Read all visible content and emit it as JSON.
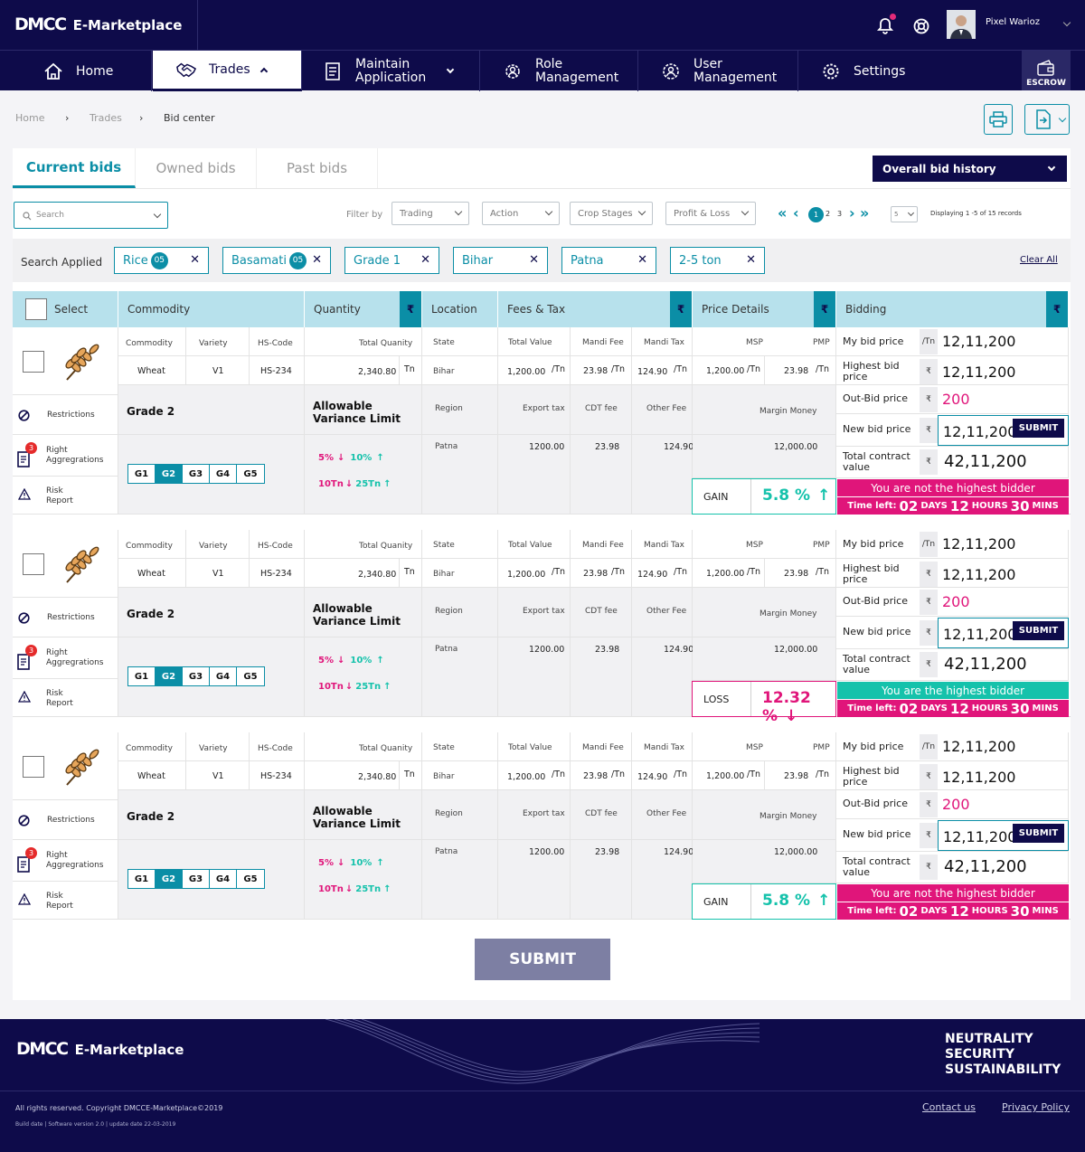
{
  "header": {
    "logo_mark": "DMCC",
    "logo_text": "E-Marketplace",
    "user_name": "Pixel Warioz"
  },
  "nav": {
    "home": "Home",
    "trades": "Trades",
    "maintain_1": "Maintain",
    "maintain_2": "Application",
    "role_1": "Role",
    "role_2": "Management",
    "user_1": "User",
    "user_2": "Management",
    "settings": "Settings",
    "escrow": "ESCROW"
  },
  "breadcrumb": [
    "Home",
    "Trades",
    "Bid center"
  ],
  "tabs": [
    "Current bids",
    "Owned bids",
    "Past bids"
  ],
  "history_select": "Overall bid history",
  "filters": {
    "search_placeholder": "Search",
    "filter_by": "Filter by",
    "trading": "Trading",
    "action": "Action",
    "crop_stages": "Crop Stages",
    "profit_loss": "Profit & Loss",
    "pages": [
      "1",
      "2",
      "3"
    ],
    "per_page": "5",
    "displaying": "Displaying 1 -5 of 15 records"
  },
  "applied": {
    "label": "Search Applied",
    "chips": [
      {
        "label": "Rice",
        "count": "05"
      },
      {
        "label": "Basamati",
        "count": "05"
      },
      {
        "label": "Grade 1",
        "count": ""
      },
      {
        "label": "Bihar",
        "count": ""
      },
      {
        "label": "Patna",
        "count": ""
      },
      {
        "label": "2-5 ton",
        "count": ""
      }
    ],
    "clear_all": "Clear All"
  },
  "table_headers": {
    "select": "Select",
    "commodity": "Commodity",
    "quantity": "Quantity",
    "location": "Location",
    "fees": "Fees & Tax",
    "price": "Price Details",
    "bidding": "Bidding",
    "rupee": "₹"
  },
  "labels": {
    "commodity": "Commodity",
    "variety": "Variety",
    "hs_code": "HS-Code",
    "total_quantity": "Total Quanity",
    "state": "State",
    "total_value": "Total Value",
    "mandi_fee": "Mandi Fee",
    "mandi_tax": "Mandi Tax",
    "msp": "MSP",
    "pmp": "PMP",
    "region": "Region",
    "export_tax": "Export tax",
    "cdt_fee": "CDT fee",
    "other_fee": "Other Fee",
    "margin_money": "Margin Money",
    "restrictions": "Restrictions",
    "right_1": "Right",
    "right_2": "Aggregrations",
    "risk_1": "Risk",
    "risk_2": "Report",
    "allowable_1": "Allowable",
    "allowable_2": "Variance Limit",
    "my_bid": "My bid price",
    "highest_1": "Highest bid",
    "highest_2": "price",
    "outbid": "Out-Bid price",
    "new_bid": "New bid price",
    "total_1": "Total contract",
    "total_2": "value",
    "per_tn": "/Tn",
    "tn": "Tn",
    "submit_small": "SUBMIT",
    "time_left": "Time left:",
    "days": "DAYS",
    "hours": "HOURS",
    "mins": "MINS",
    "gains": [
      "G1",
      "G2",
      "G3",
      "G4",
      "G5"
    ],
    "var": [
      "5%",
      "10%",
      "10Tn",
      "25Tn"
    ]
  },
  "rows": [
    {
      "commodity": "Wheat",
      "variety": "V1",
      "hs_code": "HS-234",
      "quantity": "2,340.80",
      "state": "Bihar",
      "total_value": "1,200.00",
      "mandi_fee": "23.98",
      "mandi_tax": "124.90",
      "msp": "1,200.00",
      "pmp": "23.98",
      "grade": "Grade 2",
      "region": "Patna",
      "export_tax": "1200.00",
      "cdt_fee": "23.98",
      "other_fee": "124.90",
      "margin_money": "12,000.00",
      "badge": "3",
      "my_bid": "12,11,200",
      "highest": "12,11,200",
      "outbid": "200",
      "new_bid": "12,11,200",
      "total_contract": "42,11,200",
      "pl_label": "GAIN",
      "pl_value": "5.8 %",
      "pl_type": "gain",
      "status": "You are not the highest bidder",
      "status_type": "not",
      "t_days": "02",
      "t_hours": "12",
      "t_mins": "30"
    },
    {
      "commodity": "Wheat",
      "variety": "V1",
      "hs_code": "HS-234",
      "quantity": "2,340.80",
      "state": "Bihar",
      "total_value": "1,200.00",
      "mandi_fee": "23.98",
      "mandi_tax": "124.90",
      "msp": "1,200.00",
      "pmp": "23.98",
      "grade": "Grade 2",
      "region": "Patna",
      "export_tax": "1200.00",
      "cdt_fee": "23.98",
      "other_fee": "124.90",
      "margin_money": "12,000.00",
      "badge": "3",
      "my_bid": "12,11,200",
      "highest": "12,11,200",
      "outbid": "200",
      "new_bid": "12,11,200",
      "total_contract": "42,11,200",
      "pl_label": "LOSS",
      "pl_value": "12.32 %",
      "pl_type": "loss",
      "status": "You are the highest bidder",
      "status_type": "yes",
      "t_days": "02",
      "t_hours": "12",
      "t_mins": "30"
    },
    {
      "commodity": "Wheat",
      "variety": "V1",
      "hs_code": "HS-234",
      "quantity": "2,340.80",
      "state": "Bihar",
      "total_value": "1,200.00",
      "mandi_fee": "23.98",
      "mandi_tax": "124.90",
      "msp": "1,200.00",
      "pmp": "23.98",
      "grade": "Grade 2",
      "region": "Patna",
      "export_tax": "1200.00",
      "cdt_fee": "23.98",
      "other_fee": "124.90",
      "margin_money": "12,000.00",
      "badge": "3",
      "my_bid": "12,11,200",
      "highest": "12,11,200",
      "outbid": "200",
      "new_bid": "12,11,200",
      "total_contract": "42,11,200",
      "pl_label": "GAIN",
      "pl_value": "5.8 %",
      "pl_type": "gain",
      "status": "You are not the highest bidder",
      "status_type": "not",
      "t_days": "02",
      "t_hours": "12",
      "t_mins": "30"
    }
  ],
  "submit": "SUBMIT",
  "footer": {
    "logo_mark": "DMCC",
    "logo_text": "E-Marketplace",
    "tag_1": "NEUTRALITY",
    "tag_2": "SECURITY",
    "tag_3": "SUSTAINABILITY",
    "copyright": "All rights reserved. Copyright DMCCE-Marketplace©2019",
    "build": "Build date | Software version 2.0 | update date 22-03-2019",
    "contact": "Contact us",
    "privacy": "Privacy Policy"
  },
  "colors": {
    "navy": "#0e0b4a",
    "teal": "#0b8ea6",
    "pink": "#e0157a",
    "green": "#15c2ab",
    "header_cell": "#b7e1ec"
  }
}
